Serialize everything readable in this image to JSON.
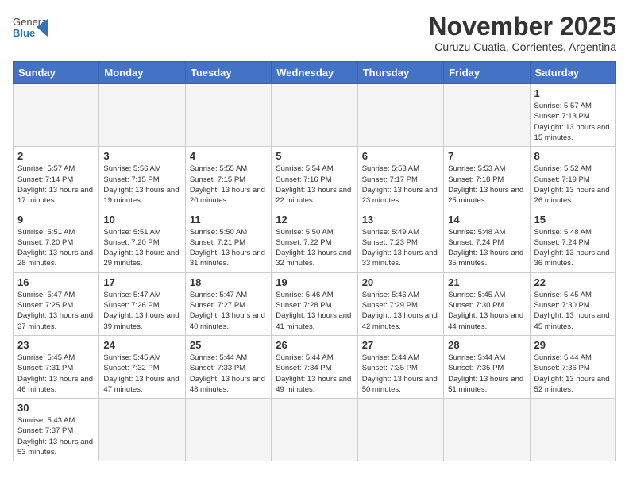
{
  "logo": {
    "text_general": "General",
    "text_blue": "Blue"
  },
  "title": "November 2025",
  "location": "Curuzu Cuatia, Corrientes, Argentina",
  "days_of_week": [
    "Sunday",
    "Monday",
    "Tuesday",
    "Wednesday",
    "Thursday",
    "Friday",
    "Saturday"
  ],
  "weeks": [
    [
      {
        "day": "",
        "info": ""
      },
      {
        "day": "",
        "info": ""
      },
      {
        "day": "",
        "info": ""
      },
      {
        "day": "",
        "info": ""
      },
      {
        "day": "",
        "info": ""
      },
      {
        "day": "",
        "info": ""
      },
      {
        "day": "1",
        "info": "Sunrise: 5:57 AM\nSunset: 7:13 PM\nDaylight: 13 hours and 15 minutes."
      }
    ],
    [
      {
        "day": "2",
        "info": "Sunrise: 5:57 AM\nSunset: 7:14 PM\nDaylight: 13 hours and 17 minutes."
      },
      {
        "day": "3",
        "info": "Sunrise: 5:56 AM\nSunset: 7:15 PM\nDaylight: 13 hours and 19 minutes."
      },
      {
        "day": "4",
        "info": "Sunrise: 5:55 AM\nSunset: 7:15 PM\nDaylight: 13 hours and 20 minutes."
      },
      {
        "day": "5",
        "info": "Sunrise: 5:54 AM\nSunset: 7:16 PM\nDaylight: 13 hours and 22 minutes."
      },
      {
        "day": "6",
        "info": "Sunrise: 5:53 AM\nSunset: 7:17 PM\nDaylight: 13 hours and 23 minutes."
      },
      {
        "day": "7",
        "info": "Sunrise: 5:53 AM\nSunset: 7:18 PM\nDaylight: 13 hours and 25 minutes."
      },
      {
        "day": "8",
        "info": "Sunrise: 5:52 AM\nSunset: 7:19 PM\nDaylight: 13 hours and 26 minutes."
      }
    ],
    [
      {
        "day": "9",
        "info": "Sunrise: 5:51 AM\nSunset: 7:20 PM\nDaylight: 13 hours and 28 minutes."
      },
      {
        "day": "10",
        "info": "Sunrise: 5:51 AM\nSunset: 7:20 PM\nDaylight: 13 hours and 29 minutes."
      },
      {
        "day": "11",
        "info": "Sunrise: 5:50 AM\nSunset: 7:21 PM\nDaylight: 13 hours and 31 minutes."
      },
      {
        "day": "12",
        "info": "Sunrise: 5:50 AM\nSunset: 7:22 PM\nDaylight: 13 hours and 32 minutes."
      },
      {
        "day": "13",
        "info": "Sunrise: 5:49 AM\nSunset: 7:23 PM\nDaylight: 13 hours and 33 minutes."
      },
      {
        "day": "14",
        "info": "Sunrise: 5:48 AM\nSunset: 7:24 PM\nDaylight: 13 hours and 35 minutes."
      },
      {
        "day": "15",
        "info": "Sunrise: 5:48 AM\nSunset: 7:24 PM\nDaylight: 13 hours and 36 minutes."
      }
    ],
    [
      {
        "day": "16",
        "info": "Sunrise: 5:47 AM\nSunset: 7:25 PM\nDaylight: 13 hours and 37 minutes."
      },
      {
        "day": "17",
        "info": "Sunrise: 5:47 AM\nSunset: 7:26 PM\nDaylight: 13 hours and 39 minutes."
      },
      {
        "day": "18",
        "info": "Sunrise: 5:47 AM\nSunset: 7:27 PM\nDaylight: 13 hours and 40 minutes."
      },
      {
        "day": "19",
        "info": "Sunrise: 5:46 AM\nSunset: 7:28 PM\nDaylight: 13 hours and 41 minutes."
      },
      {
        "day": "20",
        "info": "Sunrise: 5:46 AM\nSunset: 7:29 PM\nDaylight: 13 hours and 42 minutes."
      },
      {
        "day": "21",
        "info": "Sunrise: 5:45 AM\nSunset: 7:30 PM\nDaylight: 13 hours and 44 minutes."
      },
      {
        "day": "22",
        "info": "Sunrise: 5:45 AM\nSunset: 7:30 PM\nDaylight: 13 hours and 45 minutes."
      }
    ],
    [
      {
        "day": "23",
        "info": "Sunrise: 5:45 AM\nSunset: 7:31 PM\nDaylight: 13 hours and 46 minutes."
      },
      {
        "day": "24",
        "info": "Sunrise: 5:45 AM\nSunset: 7:32 PM\nDaylight: 13 hours and 47 minutes."
      },
      {
        "day": "25",
        "info": "Sunrise: 5:44 AM\nSunset: 7:33 PM\nDaylight: 13 hours and 48 minutes."
      },
      {
        "day": "26",
        "info": "Sunrise: 5:44 AM\nSunset: 7:34 PM\nDaylight: 13 hours and 49 minutes."
      },
      {
        "day": "27",
        "info": "Sunrise: 5:44 AM\nSunset: 7:35 PM\nDaylight: 13 hours and 50 minutes."
      },
      {
        "day": "28",
        "info": "Sunrise: 5:44 AM\nSunset: 7:35 PM\nDaylight: 13 hours and 51 minutes."
      },
      {
        "day": "29",
        "info": "Sunrise: 5:44 AM\nSunset: 7:36 PM\nDaylight: 13 hours and 52 minutes."
      }
    ],
    [
      {
        "day": "30",
        "info": "Sunrise: 5:43 AM\nSunset: 7:37 PM\nDaylight: 13 hours and 53 minutes."
      },
      {
        "day": "",
        "info": ""
      },
      {
        "day": "",
        "info": ""
      },
      {
        "day": "",
        "info": ""
      },
      {
        "day": "",
        "info": ""
      },
      {
        "day": "",
        "info": ""
      },
      {
        "day": "",
        "info": ""
      }
    ]
  ]
}
